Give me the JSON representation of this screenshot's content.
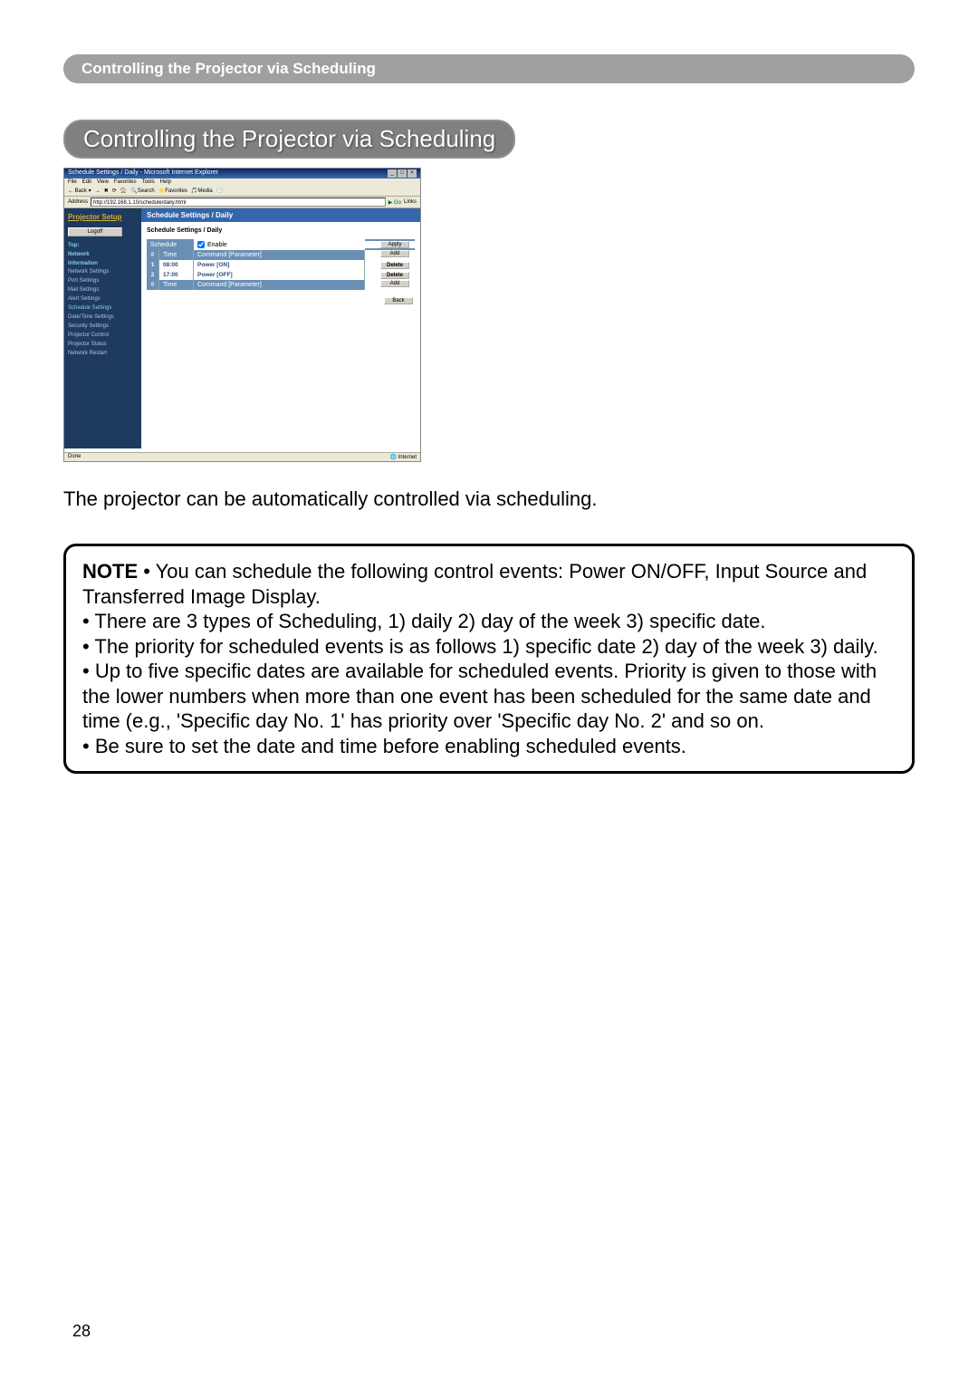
{
  "header": {
    "title": "Controlling the Projector via Scheduling"
  },
  "section": {
    "title": "Controlling the Projector via Scheduling"
  },
  "screenshot": {
    "window_title": "Schedule Settings / Daily - Microsoft Internet Explorer",
    "menu": [
      "File",
      "Edit",
      "View",
      "Favorites",
      "Tools",
      "Help"
    ],
    "toolbar": {
      "back": "Back",
      "search": "Search",
      "favorites": "Favorites",
      "media": "Media"
    },
    "address_label": "Address",
    "address_value": "http://192.168.1.10/schedule/daily.html",
    "go": "Go",
    "links": "Links",
    "sidebar": {
      "brand": "Projector Setup",
      "logoff": "Logoff",
      "top_label": "Top:",
      "network_label": "Network",
      "information_label": "Information",
      "items": [
        "Network Settings",
        "Port Settings",
        "Mail Settings",
        "Alert Settings",
        "Schedule Settings",
        "Date/Time Settings",
        "Security Settings",
        "Projector Control",
        "Projector Status",
        "Network Restart"
      ]
    },
    "main": {
      "title": "Schedule Settings / Daily",
      "subtitle": "Schedule Settings / Daily",
      "schedule_label": "Schedule",
      "enable_label": "Enable",
      "apply": "Apply",
      "col_num": "#",
      "col_time": "Time",
      "col_cmd": "Command [Parameter]",
      "add": "Add",
      "delete": "Delete",
      "back": "Back",
      "rows": [
        {
          "n": "1",
          "time": "08:00",
          "cmd": "Power [ON]"
        },
        {
          "n": "2",
          "time": "17:00",
          "cmd": "Power [OFF]"
        }
      ]
    },
    "status_left": "Done",
    "status_right": "Internet"
  },
  "body": {
    "intro": "The projector can be automatically controlled via scheduling."
  },
  "note": {
    "label": "NOTE",
    "line1": "  • You can schedule the following control events: Power ON/OFF, Input Source and Transferred Image Display.",
    "line2": "• There are 3 types of Scheduling, 1) daily 2) day of the week 3) specific date.",
    "line3": "• The priority for scheduled events is as follows 1) specific date 2) day of the week 3) daily.",
    "line4": "• Up to five specific dates are available for scheduled events. Priority is given to those with the lower numbers when more than one event has been scheduled for the same date and time (e.g., 'Specific day No. 1' has priority over 'Specific day No. 2' and so on.",
    "line5": "• Be sure to set the date and time before enabling scheduled events."
  },
  "page_number": "28"
}
